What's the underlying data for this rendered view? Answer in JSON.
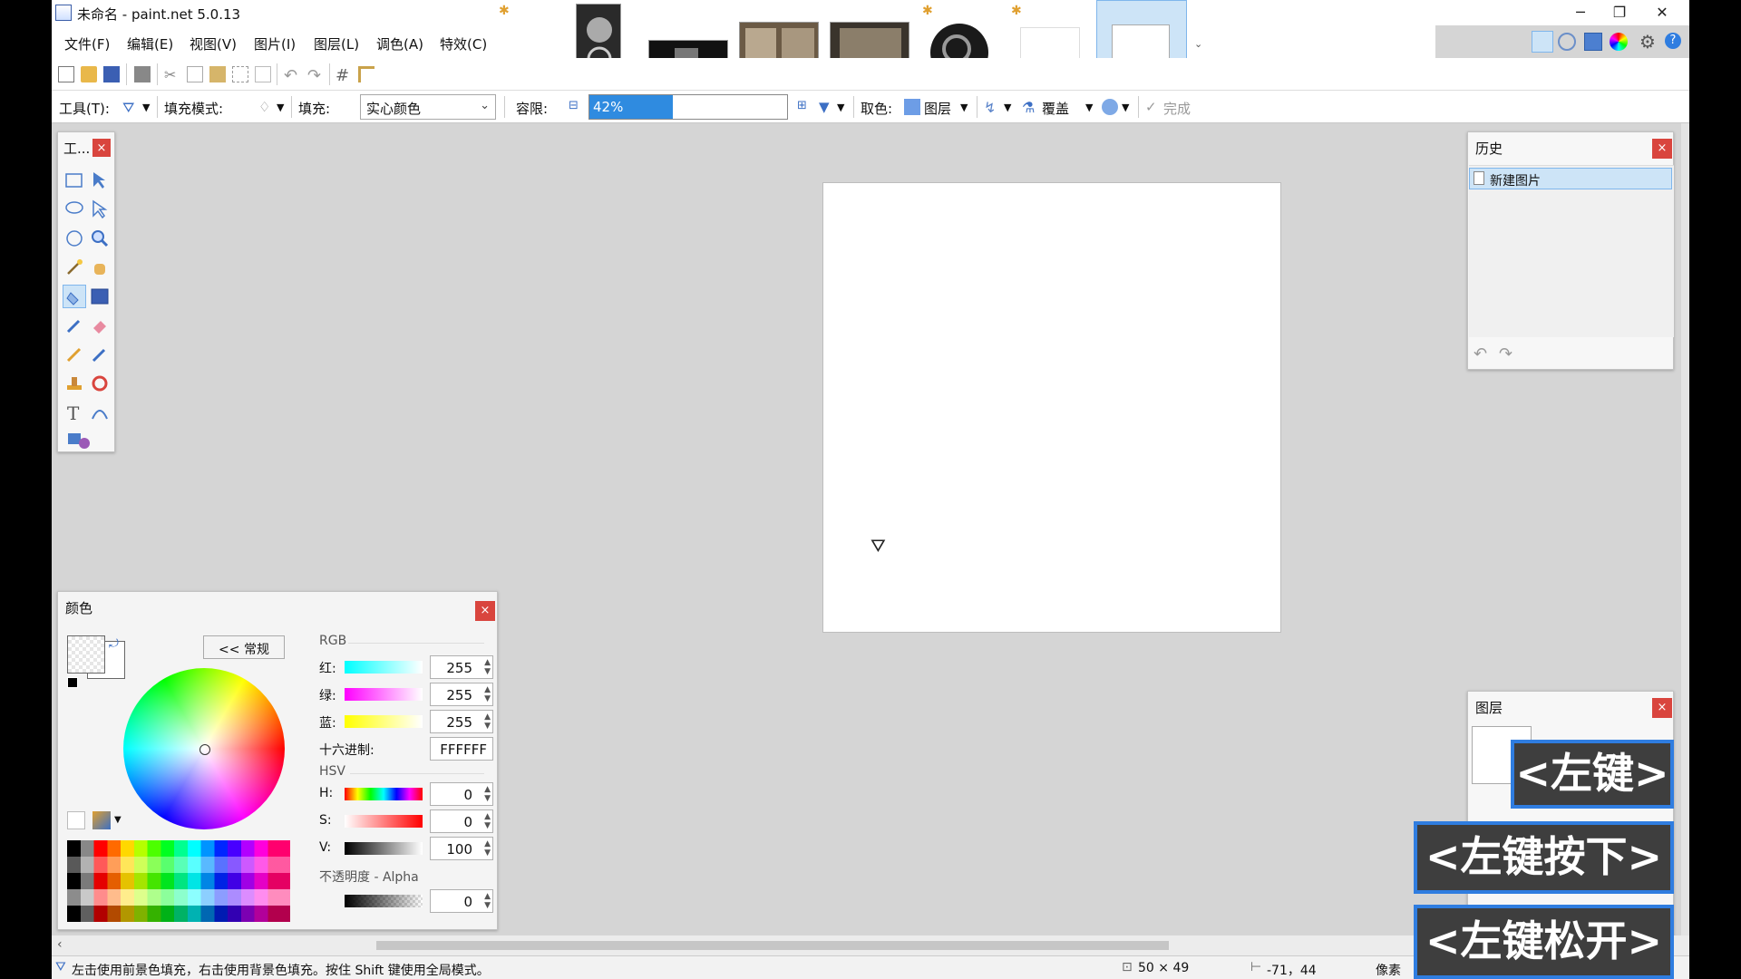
{
  "window": {
    "title": "未命名 - paint.net 5.0.13"
  },
  "menu": [
    "文件(F)",
    "编辑(E)",
    "视图(V)",
    "图片(I)",
    "图层(L)",
    "调色(A)",
    "特效(C)"
  ],
  "toolbar": {
    "tool_label": "工具(T):",
    "fill_mode_label": "填充模式:",
    "fill_label": "填充:",
    "fill_value": "实心颜色",
    "tolerance_label": "容限:",
    "tolerance_value": "42%",
    "tolerance_fraction": 0.42,
    "sample_label": "取色:",
    "sample_value": "图层",
    "blend_value": "覆盖",
    "done_label": "完成"
  },
  "tools_panel": {
    "title": "工..."
  },
  "history_panel": {
    "title": "历史",
    "items": [
      "新建图片"
    ]
  },
  "layers_panel": {
    "title": "图层"
  },
  "colors_panel": {
    "title": "颜色",
    "mode_button": "<< 常规",
    "rgb_label": "RGB",
    "red_label": "红:",
    "red": "255",
    "green_label": "绿:",
    "green": "255",
    "blue_label": "蓝:",
    "blue": "255",
    "hex_label": "十六进制:",
    "hex": "FFFFFF",
    "hsv_label": "HSV",
    "h_label": "H:",
    "h": "0",
    "s_label": "S:",
    "s": "0",
    "v_label": "V:",
    "v": "100",
    "alpha_label": "不透明度 - Alpha",
    "alpha": "0"
  },
  "status": {
    "hint": "左击使用前景色填充，右击使用背景色填充。按住 Shift 键使用全局模式。",
    "size": "50 × 49",
    "position": "-71，44",
    "unit": "像素"
  },
  "overlays": {
    "left": "<左键>",
    "down": "<左键按下>",
    "up": "<左键松开>"
  },
  "colors": {
    "accent": "#2f7de0",
    "selection": "#cde4f7",
    "close": "#d9453e"
  }
}
